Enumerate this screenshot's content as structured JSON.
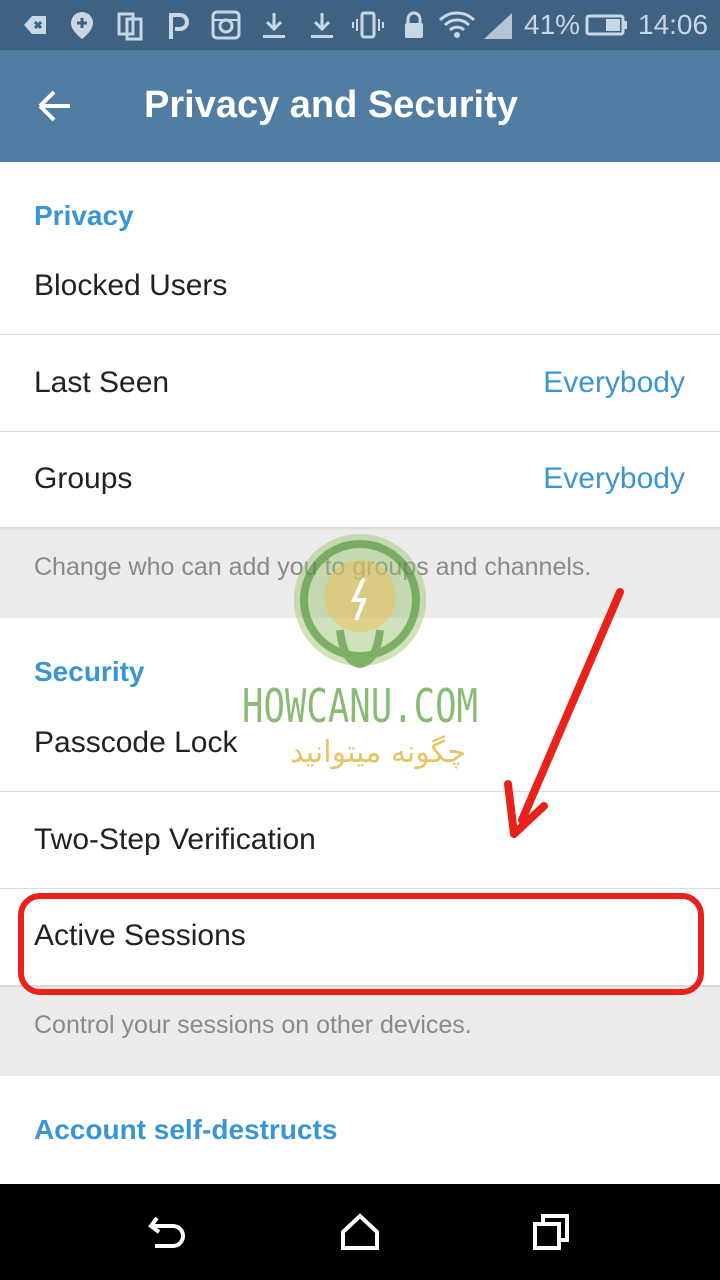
{
  "status_bar": {
    "battery_percent": "41%",
    "time": "14:06"
  },
  "app_bar": {
    "title": "Privacy and Security",
    "back_icon": "arrow-left-icon"
  },
  "privacy": {
    "header": "Privacy",
    "items": [
      {
        "label": "Blocked Users",
        "value": ""
      },
      {
        "label": "Last Seen",
        "value": "Everybody"
      },
      {
        "label": "Groups",
        "value": "Everybody"
      }
    ],
    "info": "Change who can add you to groups and channels."
  },
  "security": {
    "header": "Security",
    "items": [
      {
        "label": "Passcode Lock"
      },
      {
        "label": "Two-Step Verification"
      },
      {
        "label": "Active Sessions"
      }
    ],
    "info": "Control your sessions on other devices."
  },
  "account": {
    "header": "Account self-destructs"
  },
  "watermark": {
    "text": "HOWCANU.COM",
    "subtext": "چگونه میتوانید"
  },
  "annotation": {
    "color": "#e8221a"
  },
  "colors": {
    "status_bar": "#3f6283",
    "app_bar": "#527da3",
    "accent": "#3a95d5"
  },
  "nav_bar": {
    "icons": [
      "back-icon",
      "home-icon",
      "recents-icon"
    ]
  }
}
